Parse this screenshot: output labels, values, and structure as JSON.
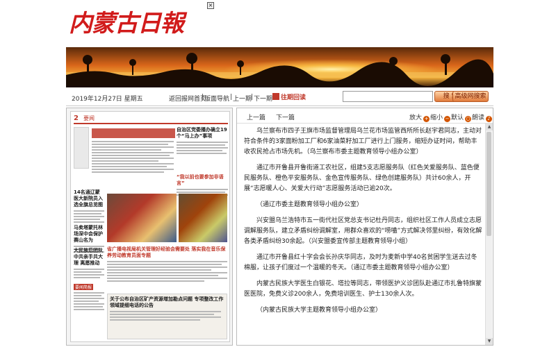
{
  "masthead": {
    "logo_text": "内蒙古日報",
    "close_label": "×"
  },
  "toolbar": {
    "date": "2019年12月27日  星期五",
    "nav": [
      "返回报网首页",
      "版面导航",
      "上一期",
      "下一期"
    ],
    "archive_label": "往期回读",
    "search_value": "",
    "search_button": "搜 索",
    "advanced_button": "高级网搜索"
  },
  "thumbnail": {
    "page_number": "2",
    "page_name": "要闻",
    "headlines": [
      "自治区党委播办确立19个“马上办”事项",
      "“我以前也要参加非语言”",
      "14名通辽蒙医大新院员入选全旗总览图",
      "马卖塔蒙托林场深中会保护赛山名为",
      "大民族后团队中共亲手共大理 离愿推动",
      "要闻简报",
      "省广播电视局机关管理好经验会需要处 落实我在音乐保养劳动教育员面专题",
      "关于公布自治区矿产资源增加勘点问题 专项整改工作领域提细电话的公告"
    ]
  },
  "article_toolbar": {
    "prev": "上一篇",
    "next": "下一篇",
    "zoom_in": "放大",
    "zoom_out": "缩小",
    "default": "默认",
    "read": "朗读"
  },
  "article": {
    "paragraphs": [
      "乌兰察布市四子王旗市场监督管理局乌兰花市场监管西所所长赵宇君同志，主动对符合条件的3家面粉加工厂和6家油菜籽加工厂进行上门服务，缩短办证时间，帮助丰收农民抢占市场先机。（乌兰察布市委主题教育领导小组办公室）",
      "通辽市开鲁县开鲁街道工农社区，组建5支志愿服务队（红色关爱服务队、蓝色便民服务队、橙色平安服务队、金色宣传服务队、绿色创建服务队）共计60余人，开展“志愿暖人心、关爱大行动”志愿服务活动已逾20次。",
      "（通辽市委主题教育领导小组办公室）",
      "兴安盟乌兰浩特市五一街代社区党总支书记杜丹同志，组织社区工作人员成立志愿调解服务队，建立矛盾纠纷调解室，用群众喜欢的“唠嗑”方式解决邻里纠纷，有效化解各类矛盾纠纷30余起。（兴安盟委宣传部主题教育领导小组）",
      "通辽市开鲁县红十字会会长孙庆华同志，及时为麦新中学40名贫困学生送去过冬棉服，让孩子们度过一个温暖的冬天。（通辽市委主题教育领导小组办公室）",
      "内蒙古民族大学医生白银花、塔拉等同志，带领医护义诊团队赴通辽市扎鲁特旗蒙医医院，免费义诊200余人，免费培训医生、护士130余人次。",
      "（内蒙古民族大学主题教育领导小组办公室）"
    ]
  },
  "colors": {
    "accent": "#c0392b",
    "logo": "#d11b1b"
  }
}
